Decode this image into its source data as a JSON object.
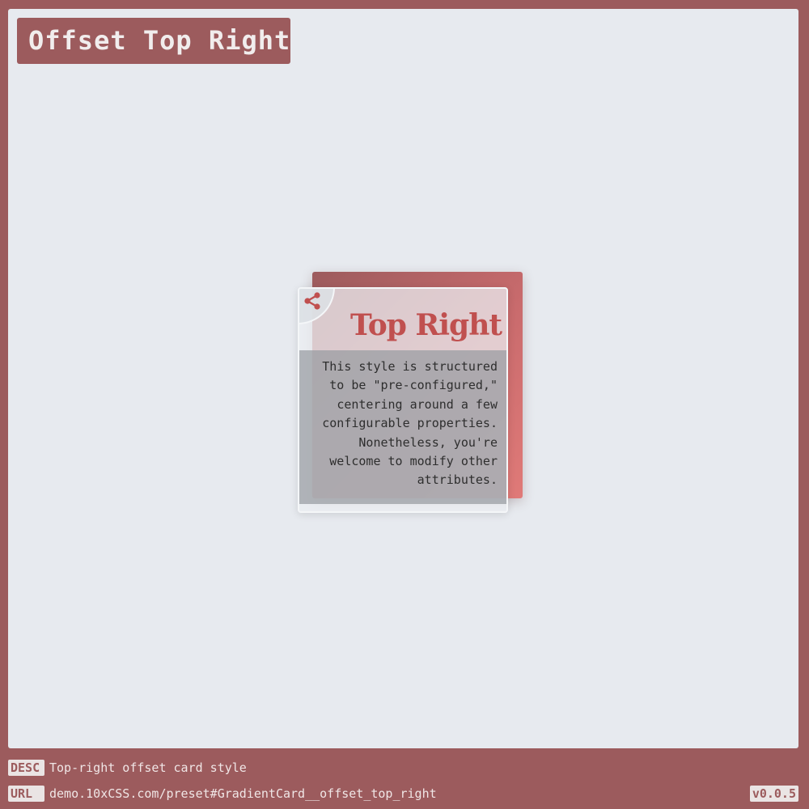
{
  "page": {
    "title": "Offset Top Right"
  },
  "card": {
    "title": "Top Right",
    "text": "This style is structured to be \"pre-configured,\" centering around a few configurable properties. Nonetheless, you're welcome to modify other attributes.",
    "icon": "share-icon"
  },
  "footer": {
    "desc_tag": "DESC",
    "desc_text": "Top-right offset card style",
    "url_tag": "URL",
    "url_text": "demo.10xCSS.com/preset#GradientCard__offset_top_right",
    "version": "v0.0.5"
  },
  "colors": {
    "frame": "#9c5b5d",
    "stage": "#e7eaef",
    "accent": "#c0504f",
    "gradient_start": "#9c5b5d",
    "gradient_end": "#e07a78"
  }
}
